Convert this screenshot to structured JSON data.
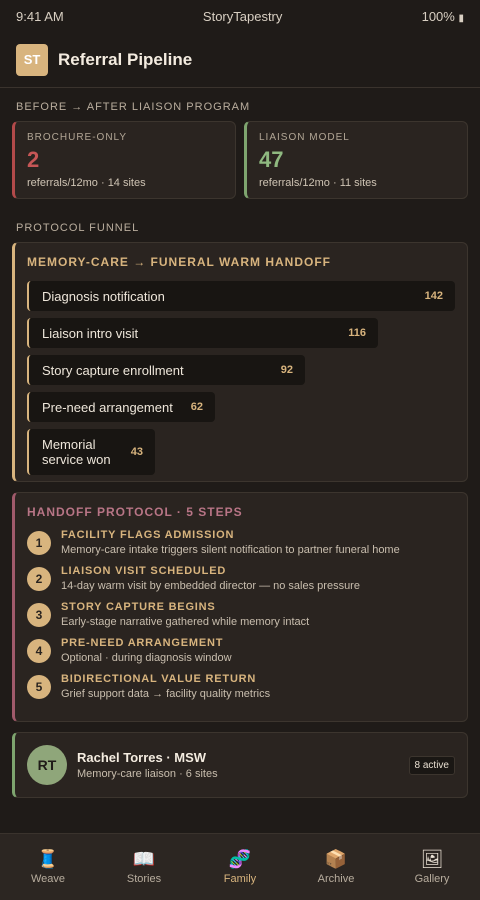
{
  "status": {
    "time": "9:41 AM",
    "app": "StoryTapestry",
    "battery": "100%"
  },
  "header": {
    "logo": "ST",
    "title": "Referral Pipeline"
  },
  "before_after": {
    "label": "BEFORE → AFTER LIAISON PROGRAM",
    "left": {
      "title": "BROCHURE-ONLY",
      "value": "2",
      "sub": "referrals/12mo · 14 sites",
      "accent": "#c65656"
    },
    "right": {
      "title": "LIAISON MODEL",
      "value": "47",
      "sub": "referrals/12mo · 11 sites",
      "accent": "#8fb980"
    }
  },
  "funnel": {
    "label": "PROTOCOL FUNNEL",
    "title": "MEMORY-CARE → FUNERAL WARM HANDOFF",
    "rows": [
      {
        "label": "Diagnosis notification",
        "count": "142",
        "fraction": 1.0
      },
      {
        "label": "Liaison intro visit",
        "count": "116",
        "fraction": 0.82
      },
      {
        "label": "Story capture enrollment",
        "count": "92",
        "fraction": 0.65
      },
      {
        "label": "Pre-need arrangement",
        "count": "62",
        "fraction": 0.44
      },
      {
        "label": "Memorial service won",
        "count": "43",
        "fraction": 0.3
      }
    ]
  },
  "protocol": {
    "title": "HANDOFF PROTOCOL · 5 STEPS",
    "steps": [
      {
        "num": "1",
        "title": "FACILITY FLAGS ADMISSION",
        "desc": "Memory-care intake triggers silent notification to partner funeral home"
      },
      {
        "num": "2",
        "title": "LIAISON VISIT SCHEDULED",
        "desc": "14-day warm visit by embedded director — no sales pressure"
      },
      {
        "num": "3",
        "title": "STORY CAPTURE BEGINS",
        "desc": "Early-stage narrative gathered while memory intact"
      },
      {
        "num": "4",
        "title": "PRE-NEED ARRANGEMENT",
        "desc": "Optional · during diagnosis window"
      },
      {
        "num": "5",
        "title": "BIDIRECTIONAL VALUE RETURN",
        "desc": "Grief support data → facility quality metrics"
      }
    ]
  },
  "liaison": {
    "initials": "RT",
    "name": "Rachel Torres · MSW",
    "sub": "Memory-care liaison · 6 sites",
    "badge": "8 active"
  },
  "tabs": [
    {
      "label": "Weave",
      "icon": "🧵",
      "icon_name": "thread-spool-icon"
    },
    {
      "label": "Stories",
      "icon": "📖",
      "icon_name": "open-book-icon"
    },
    {
      "label": "Family",
      "icon": "🧬",
      "icon_name": "family-tree-icon",
      "active": true
    },
    {
      "label": "Archive",
      "icon": "📦",
      "icon_name": "archive-box-icon"
    },
    {
      "label": "Gallery",
      "icon": "🖼",
      "icon_name": "framed-picture-icon"
    }
  ]
}
